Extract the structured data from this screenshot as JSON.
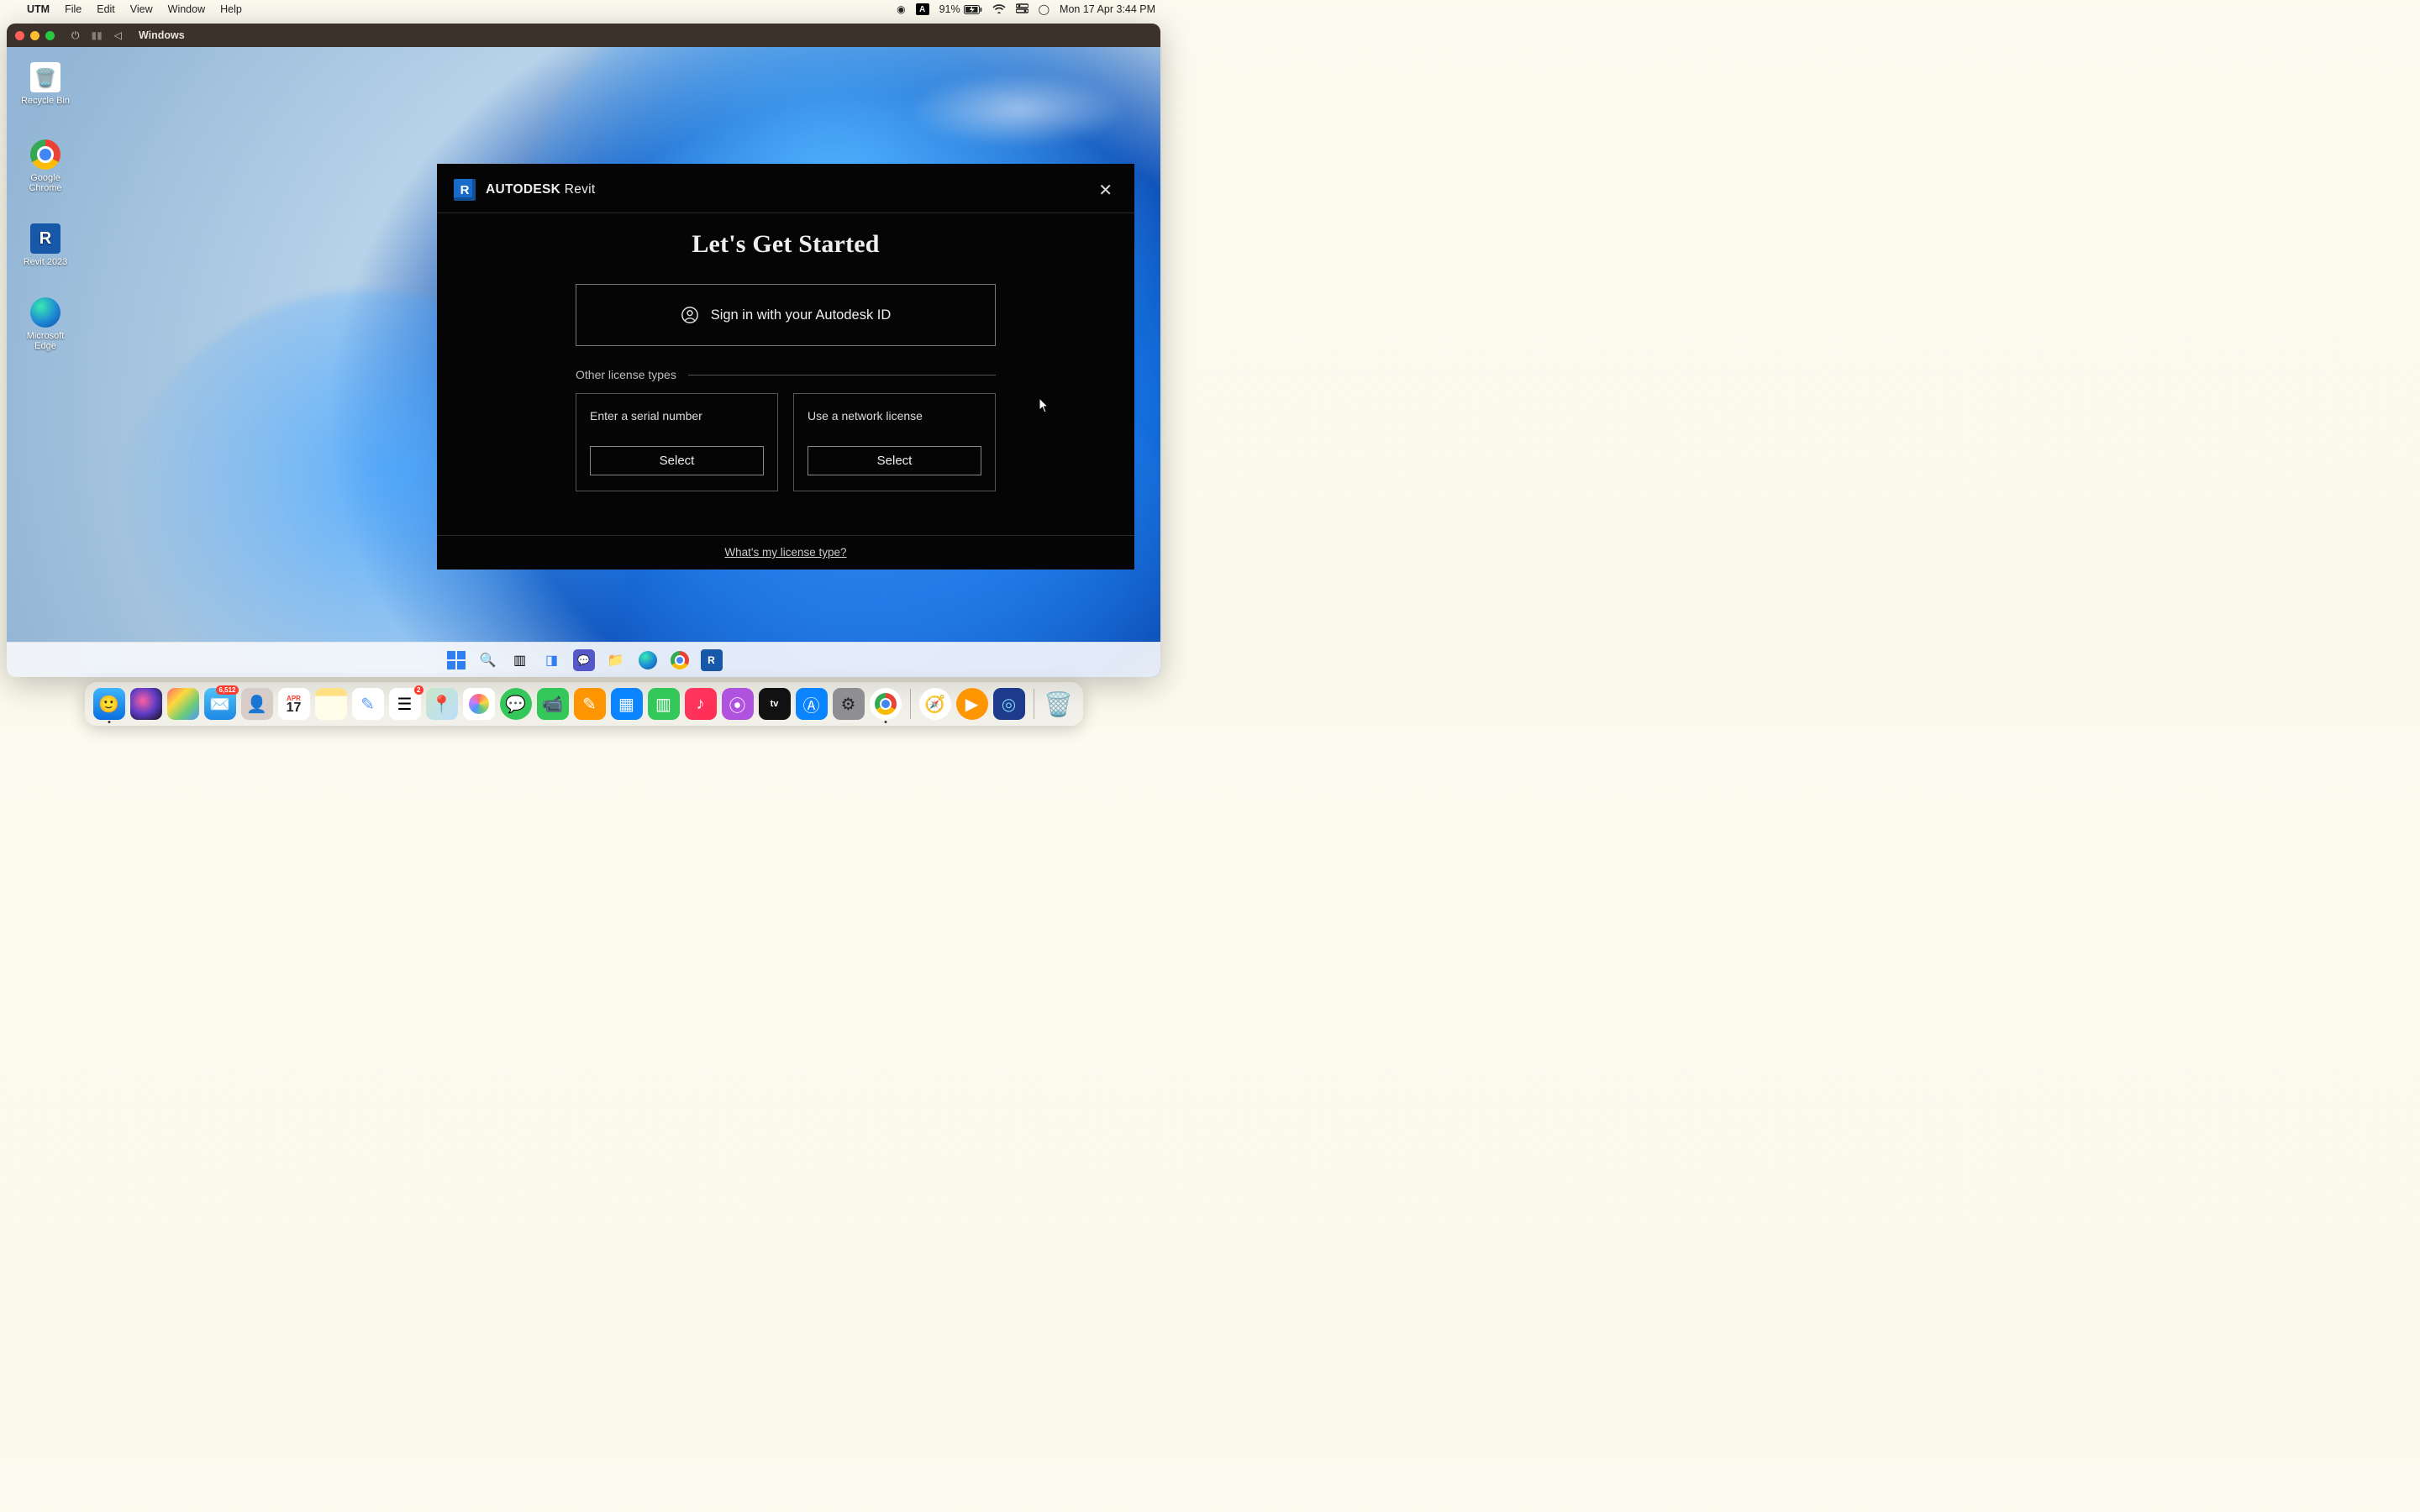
{
  "mac_menubar": {
    "app_name": "UTM",
    "items": [
      "File",
      "Edit",
      "View",
      "Window",
      "Help"
    ],
    "battery": "91%",
    "datetime": "Mon 17 Apr  3:44 PM",
    "a_indicator": "A"
  },
  "utm": {
    "title": "Windows"
  },
  "desktop_icons": {
    "recycle": "Recycle Bin",
    "chrome": "Google Chrome",
    "revit": "Revit 2023",
    "revit_badge": "R",
    "edge": "Microsoft Edge"
  },
  "revit": {
    "brand_bold": "AUTODESK",
    "brand_light": " Revit",
    "logo_letter": "R",
    "title": "Let's Get Started",
    "signin": "Sign in with your Autodesk ID",
    "other_label": "Other license types",
    "card1_title": "Enter a serial number",
    "card2_title": "Use a network license",
    "select_label": "Select",
    "footer_link": "What's my license type?"
  },
  "dock": {
    "mail_badge": "6,512",
    "reminders_badge": "2",
    "cal_month": "APR",
    "cal_day": "17",
    "tv_label": "tv"
  }
}
